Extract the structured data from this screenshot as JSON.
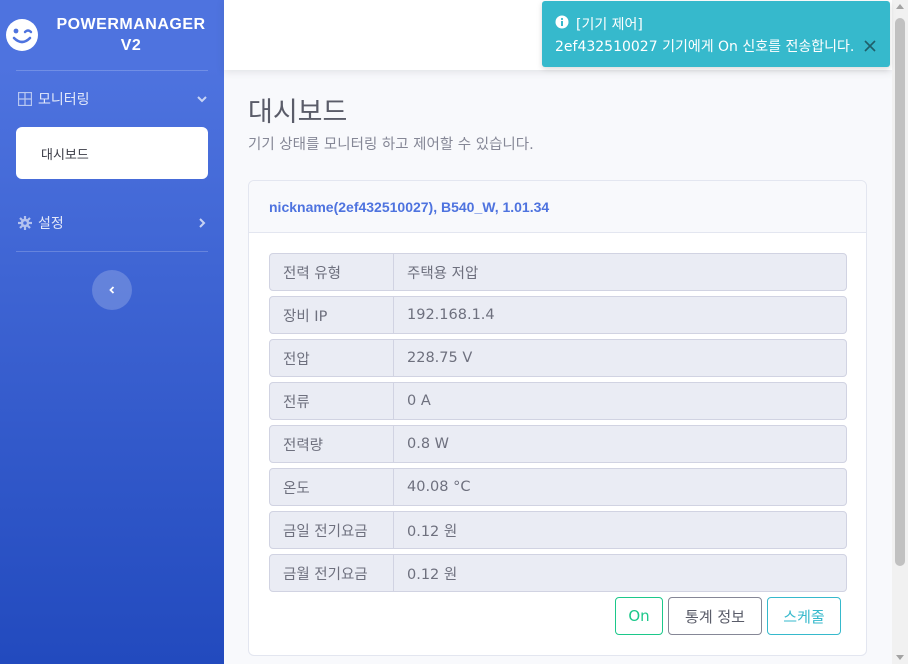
{
  "brand": {
    "line1": "POWERMANAGER",
    "line2": "V2"
  },
  "sidebar": {
    "monitoring_label": "모니터링",
    "dashboard_label": "대시보드",
    "settings_label": "설정"
  },
  "page": {
    "title": "대시보드",
    "subtitle": "기기 상태를 모니터링 하고 제어할 수 있습니다."
  },
  "card": {
    "header": "nickname(2ef432510027), B540_W, 1.01.34",
    "rows": [
      {
        "key": "전력 유형",
        "value": "주택용 저압"
      },
      {
        "key": "장비 IP",
        "value": "192.168.1.4"
      },
      {
        "key": "전압",
        "value": "228.75 V"
      },
      {
        "key": "전류",
        "value": "0 A"
      },
      {
        "key": "전력량",
        "value": "0.8 W"
      },
      {
        "key": "온도",
        "value": "40.08 °C"
      },
      {
        "key": "금일 전기요금",
        "value": "0.12 원"
      },
      {
        "key": "금월 전기요금",
        "value": "0.12 원"
      }
    ],
    "buttons": {
      "on": "On",
      "stats": "통계 정보",
      "schedule": "스케줄"
    }
  },
  "toast": {
    "title": "[기기 제어]",
    "message": "2ef432510027 기기에게 On 신호를 전송합니다."
  },
  "icons": {
    "logo": "smile-wink-icon",
    "monitoring": "grid-icon",
    "settings": "gear-icon",
    "collapse": "chevron-left-icon",
    "toast": "info-circle-icon",
    "close": "close-icon"
  },
  "colors": {
    "primary": "#4e73df",
    "success": "#1cc88a",
    "info": "#36b9cc",
    "secondary": "#858796"
  }
}
